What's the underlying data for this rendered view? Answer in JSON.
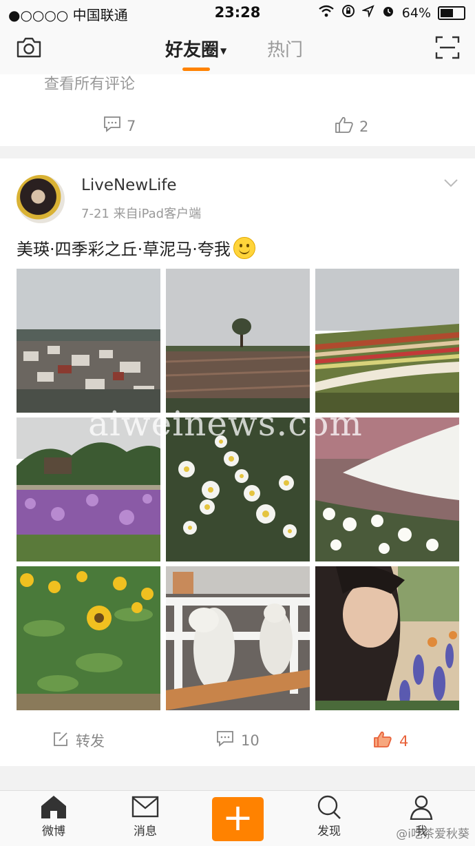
{
  "status_bar": {
    "carrier": "●○○○○ 中国联通",
    "time": "23:28",
    "battery": "64%",
    "battery_level": 0.64
  },
  "nav": {
    "tab_active": "好友圈",
    "tab_other": "热门"
  },
  "prev_card": {
    "view_all_comments": "查看所有评论",
    "comments": "7",
    "likes": "2"
  },
  "post": {
    "username": "LiveNewLife",
    "meta": "7-21  来自iPad客户端",
    "text": "美瑛·四季彩之丘·草泥马·夸我",
    "repost_label": "转发",
    "comments": "10",
    "likes": "4",
    "like_color": "#e8623a"
  },
  "watermark": "aiweinews.com",
  "tab_bar": {
    "home": "微博",
    "messages": "消息",
    "discover": "发现",
    "me": "我",
    "accent": "#ff8200"
  },
  "credit": "@i吃茶爱秋葵"
}
